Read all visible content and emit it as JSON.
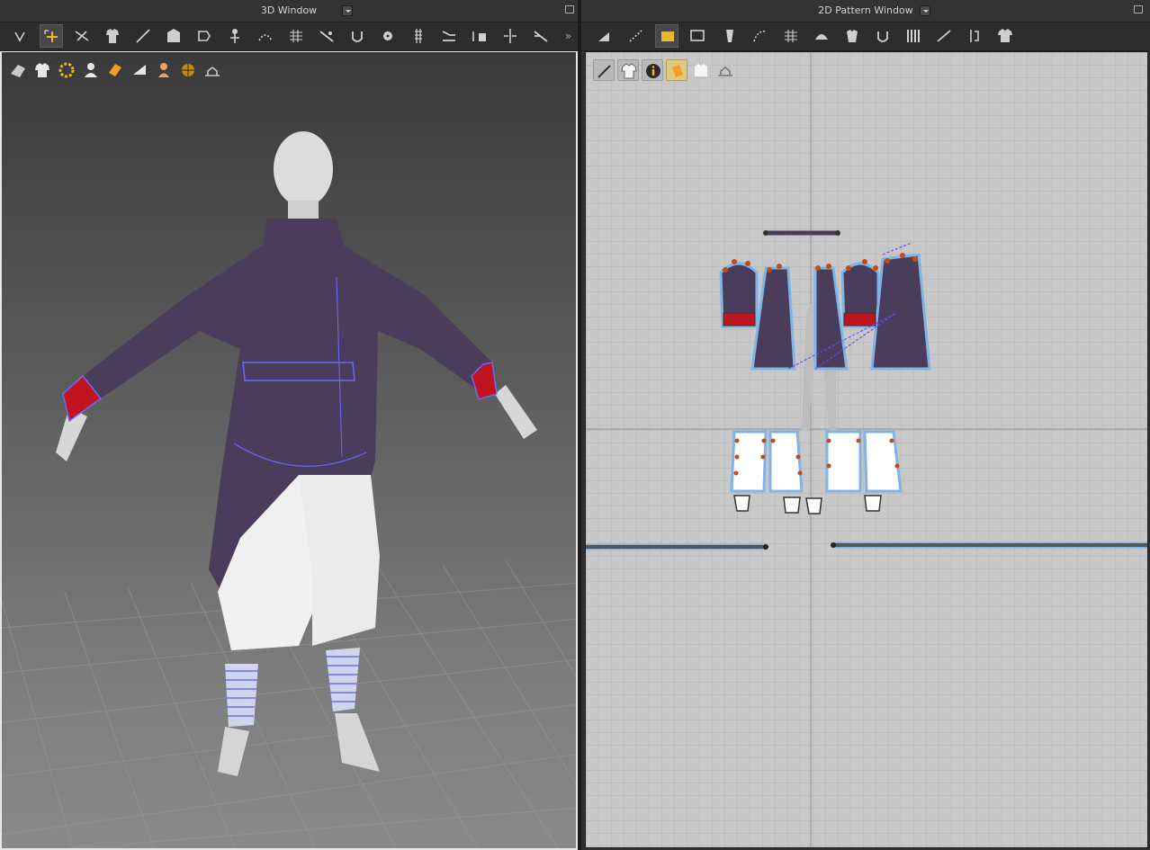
{
  "window3d": {
    "title": "3D Window",
    "toolbar_icons": [
      "select-icon",
      "move-icon",
      "tack-icon",
      "garment-fit-icon",
      "measure-icon",
      "fold-icon",
      "arrangement-icon",
      "pin-icon",
      "sewing-icon",
      "grid-icon",
      "edit-line-icon",
      "steam-icon",
      "button-icon",
      "zipper-icon",
      "tape-icon",
      "flip-icon",
      "align-icon",
      "cut-icon",
      "more-icon"
    ],
    "view_icons": [
      "render-icon",
      "shirt-icon",
      "texture-icon",
      "avatar-icon",
      "texture-surface-icon",
      "mesh-icon",
      "user-icon",
      "globe-icon",
      "scale-icon"
    ]
  },
  "window2d": {
    "title": "2D Pattern Window",
    "toolbar_icons": [
      "transform-icon",
      "edit-point-icon",
      "polygon-icon",
      "rectangle-icon",
      "internal-line-icon",
      "edit-curve-icon",
      "grid-icon",
      "fold-icon",
      "arrangement-icon",
      "seam-icon",
      "notch-icon",
      "fold-line-icon",
      "dart-icon",
      "garment-icon"
    ],
    "view_icons": [
      "pencil-icon",
      "shirt-icon",
      "info-icon",
      "texture-icon",
      "avatar-shirt-icon",
      "scale-icon"
    ]
  },
  "colors": {
    "coat": "#4a3d5c",
    "cuff": "#c01520",
    "pants": "#f2f2f2",
    "sewing_line": "#5f5fff",
    "point": "#c24a16",
    "selected_outline": "#7fb4e6"
  }
}
